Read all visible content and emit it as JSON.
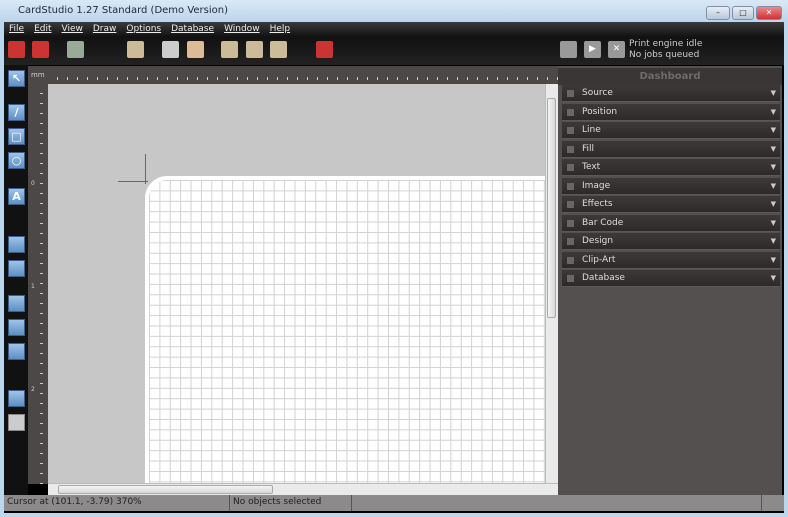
{
  "window": {
    "title": "CardStudio 1.27 Standard (Demo Version)",
    "minimize": "–",
    "maximize": "□",
    "close": "✕"
  },
  "menu": [
    "File",
    "Edit",
    "View",
    "Draw",
    "Options",
    "Database",
    "Window",
    "Help"
  ],
  "print_engine": {
    "status": "Print engine idle",
    "queue": "No jobs queued"
  },
  "ruler": {
    "unit": "mm",
    "v_labels": [
      "0",
      "1",
      "2"
    ]
  },
  "dashboard": {
    "title": "Dashboard",
    "items": [
      "Source",
      "Position",
      "Line",
      "Fill",
      "Text",
      "Image",
      "Effects",
      "Bar Code",
      "Design",
      "Clip-Art",
      "Database"
    ]
  },
  "status": {
    "cursor": "Cursor at (101.1, -3.79) 370%",
    "selection": "No objects selected",
    "extra": ""
  },
  "tools": {
    "text_tool": "A"
  }
}
